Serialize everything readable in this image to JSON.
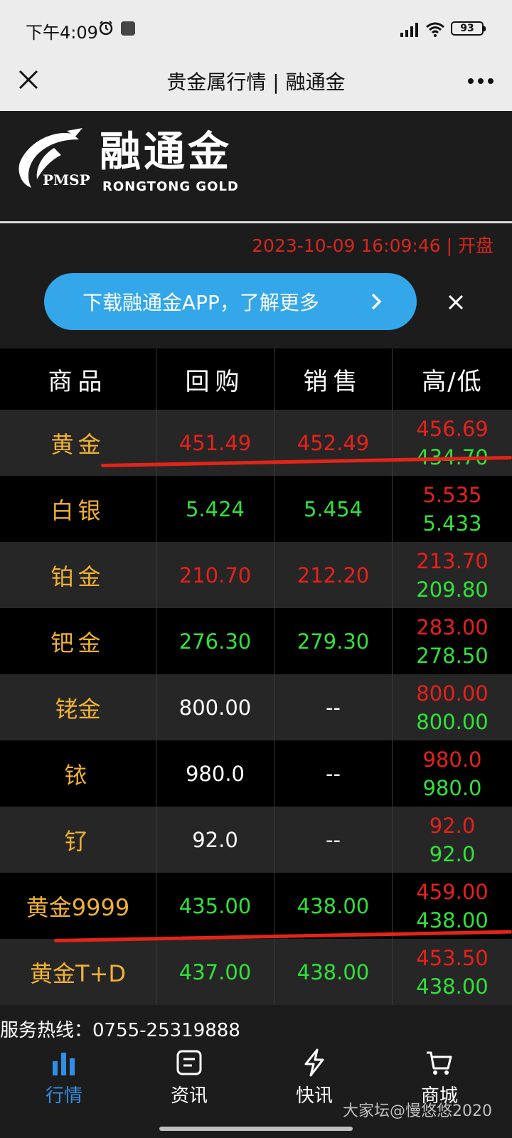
{
  "status": {
    "time": "下午4:09",
    "battery": "93"
  },
  "navbar": {
    "title": "贵金属行情 | 融通金"
  },
  "brand": {
    "logo_text": "PMSP",
    "name_cn": "融通金",
    "name_en": "RONGTONG GOLD"
  },
  "timestamp": "2023-10-09 16:09:46 | 开盘",
  "promo": {
    "text": "下载融通金APP，了解更多"
  },
  "table": {
    "headers": [
      "商品",
      "回购",
      "销售",
      "高/低"
    ],
    "rows": [
      {
        "name": "黄金",
        "buy": "451.49",
        "sell": "452.49",
        "high": "456.69",
        "low": "434.70"
      },
      {
        "name": "白银",
        "buy": "5.424",
        "sell": "5.454",
        "high": "5.535",
        "low": "5.433"
      },
      {
        "name": "铂金",
        "buy": "210.70",
        "sell": "212.20",
        "high": "213.70",
        "low": "209.80"
      },
      {
        "name": "钯金",
        "buy": "276.30",
        "sell": "279.30",
        "high": "283.00",
        "low": "278.50"
      },
      {
        "name": "铑金",
        "buy": "800.00",
        "sell": "--",
        "high": "800.00",
        "low": "800.00"
      },
      {
        "name": "铱",
        "buy": "980.0",
        "sell": "--",
        "high": "980.0",
        "low": "980.0"
      },
      {
        "name": "钌",
        "buy": "92.0",
        "sell": "--",
        "high": "92.0",
        "low": "92.0"
      },
      {
        "name": "黄金9999",
        "buy": "435.00",
        "sell": "438.00",
        "high": "459.00",
        "low": "438.00"
      },
      {
        "name": "黄金T+D",
        "buy": "437.00",
        "sell": "438.00",
        "high": "453.50",
        "low": "438.00"
      }
    ]
  },
  "hotline": "服务热线：0755-25319888",
  "tabs": [
    {
      "label": "行情",
      "icon": "bar-chart-icon"
    },
    {
      "label": "资讯",
      "icon": "news-icon"
    },
    {
      "label": "快讯",
      "icon": "lightning-icon"
    },
    {
      "label": "商城",
      "icon": "cart-icon"
    }
  ],
  "watermark": "大家坛@慢悠悠2020",
  "colors": {
    "up": "#e8201c",
    "down": "#30e23a",
    "gold_name": "#f0b233",
    "accent": "#2f8fe6",
    "promo": "#33a7ea"
  }
}
